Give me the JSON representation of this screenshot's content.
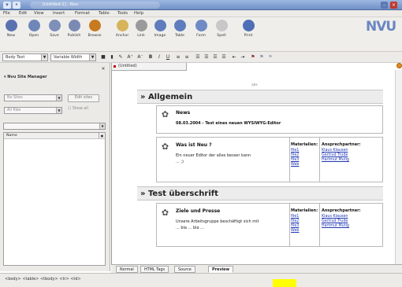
{
  "window": {
    "title": "[Untitled-1] - Nvu",
    "left_btn": "▾",
    "pin_btn": "•",
    "minimize": "–",
    "close": "×"
  },
  "menu": [
    "File",
    "Edit",
    "View",
    "Insert",
    "Format",
    "Table",
    "Tools",
    "Help"
  ],
  "toolbar": {
    "items": [
      {
        "label": "New",
        "icon": "new-icon",
        "color": "#5a73b0"
      },
      {
        "label": "Open",
        "icon": "open-icon",
        "color": "#6f87b8"
      },
      {
        "label": "Save",
        "icon": "save-icon",
        "color": "#7e8fb8"
      },
      {
        "label": "Publish",
        "icon": "publish-icon",
        "color": "#7a8ab3"
      },
      {
        "label": "Browse",
        "icon": "browse-icon",
        "color": "#c87a21"
      },
      {
        "label": "Anchor",
        "icon": "anchor-icon",
        "color": "#d7b45b"
      },
      {
        "label": "Link",
        "icon": "link-icon",
        "color": "#9a9a9a"
      },
      {
        "label": "Image",
        "icon": "image-icon",
        "color": "#5f7dbd"
      },
      {
        "label": "Table",
        "icon": "table-icon",
        "color": "#5f7dbd"
      },
      {
        "label": "Form",
        "icon": "form-icon",
        "color": "#6f8ac4"
      },
      {
        "label": "Spell",
        "icon": "spell-icon",
        "color": "#c8c8c8"
      },
      {
        "label": "Print",
        "icon": "print-icon",
        "color": "#4e6fb6"
      }
    ],
    "logo": "NVU"
  },
  "format": {
    "paragraph": "Body Text",
    "font": "Variable Width",
    "buttons": [
      "■",
      "▮",
      "✎",
      "A⁺",
      "A⁻",
      "B",
      "I",
      "U",
      "≡",
      "≡",
      "☰",
      "☰",
      "☰",
      "☰",
      "⇤",
      "⇥",
      "⚑",
      "⚑",
      "⚑"
    ]
  },
  "sidebar": {
    "close": "×",
    "title": "▾ Nvu Site Manager",
    "site_select": "No Sites",
    "edit_sites": "Edit sites",
    "filter_select": "All files",
    "show_label": "Show all",
    "folder_select": "",
    "list_header": "Name"
  },
  "document": {
    "tab": "(Untitled)",
    "sections": [
      {
        "heading": "» Allgemein",
        "cards": [
          {
            "title": "News",
            "text": "08.03.2004 - Test eines neuen WYSIWYG-Editor"
          },
          {
            "title": "Was ist Neu ?",
            "text": "Ein neuer Editor der alles besser kann ... ;)",
            "materials_header": "Materialien:",
            "materials": [
              "file1",
              "file2",
              "file3",
              "Web"
            ],
            "contact_header": "Ansprechpartner:",
            "contacts": [
              "Klaus Klausen",
              "Gertrud Trude",
              "Hartmut Mutig"
            ]
          }
        ]
      },
      {
        "heading": "» Test überschrift",
        "cards": [
          {
            "title": "Ziele und Presse",
            "text": "Unsere Arbeitsgruppe beschäftigt sich mit ... bla ... bla ...",
            "materials_header": "Materialien:",
            "materials": [
              "file1",
              "file2",
              "file3",
              "Web"
            ],
            "contact_header": "Ansprechpartner:",
            "contacts": [
              "Klaus Klausen",
              "Gertrud Trude",
              "Hartmut Mutig"
            ]
          }
        ]
      }
    ],
    "doc_top_marker": "abs"
  },
  "edit_tabs": [
    "Normal",
    "HTML Tags",
    "Source",
    "Preview"
  ],
  "status": "<body> <table> <tbody> <tr> <td>",
  "colors": {
    "titlebar": "#7b98cf",
    "link": "#1f36b3",
    "highlight": "#ffff00"
  }
}
